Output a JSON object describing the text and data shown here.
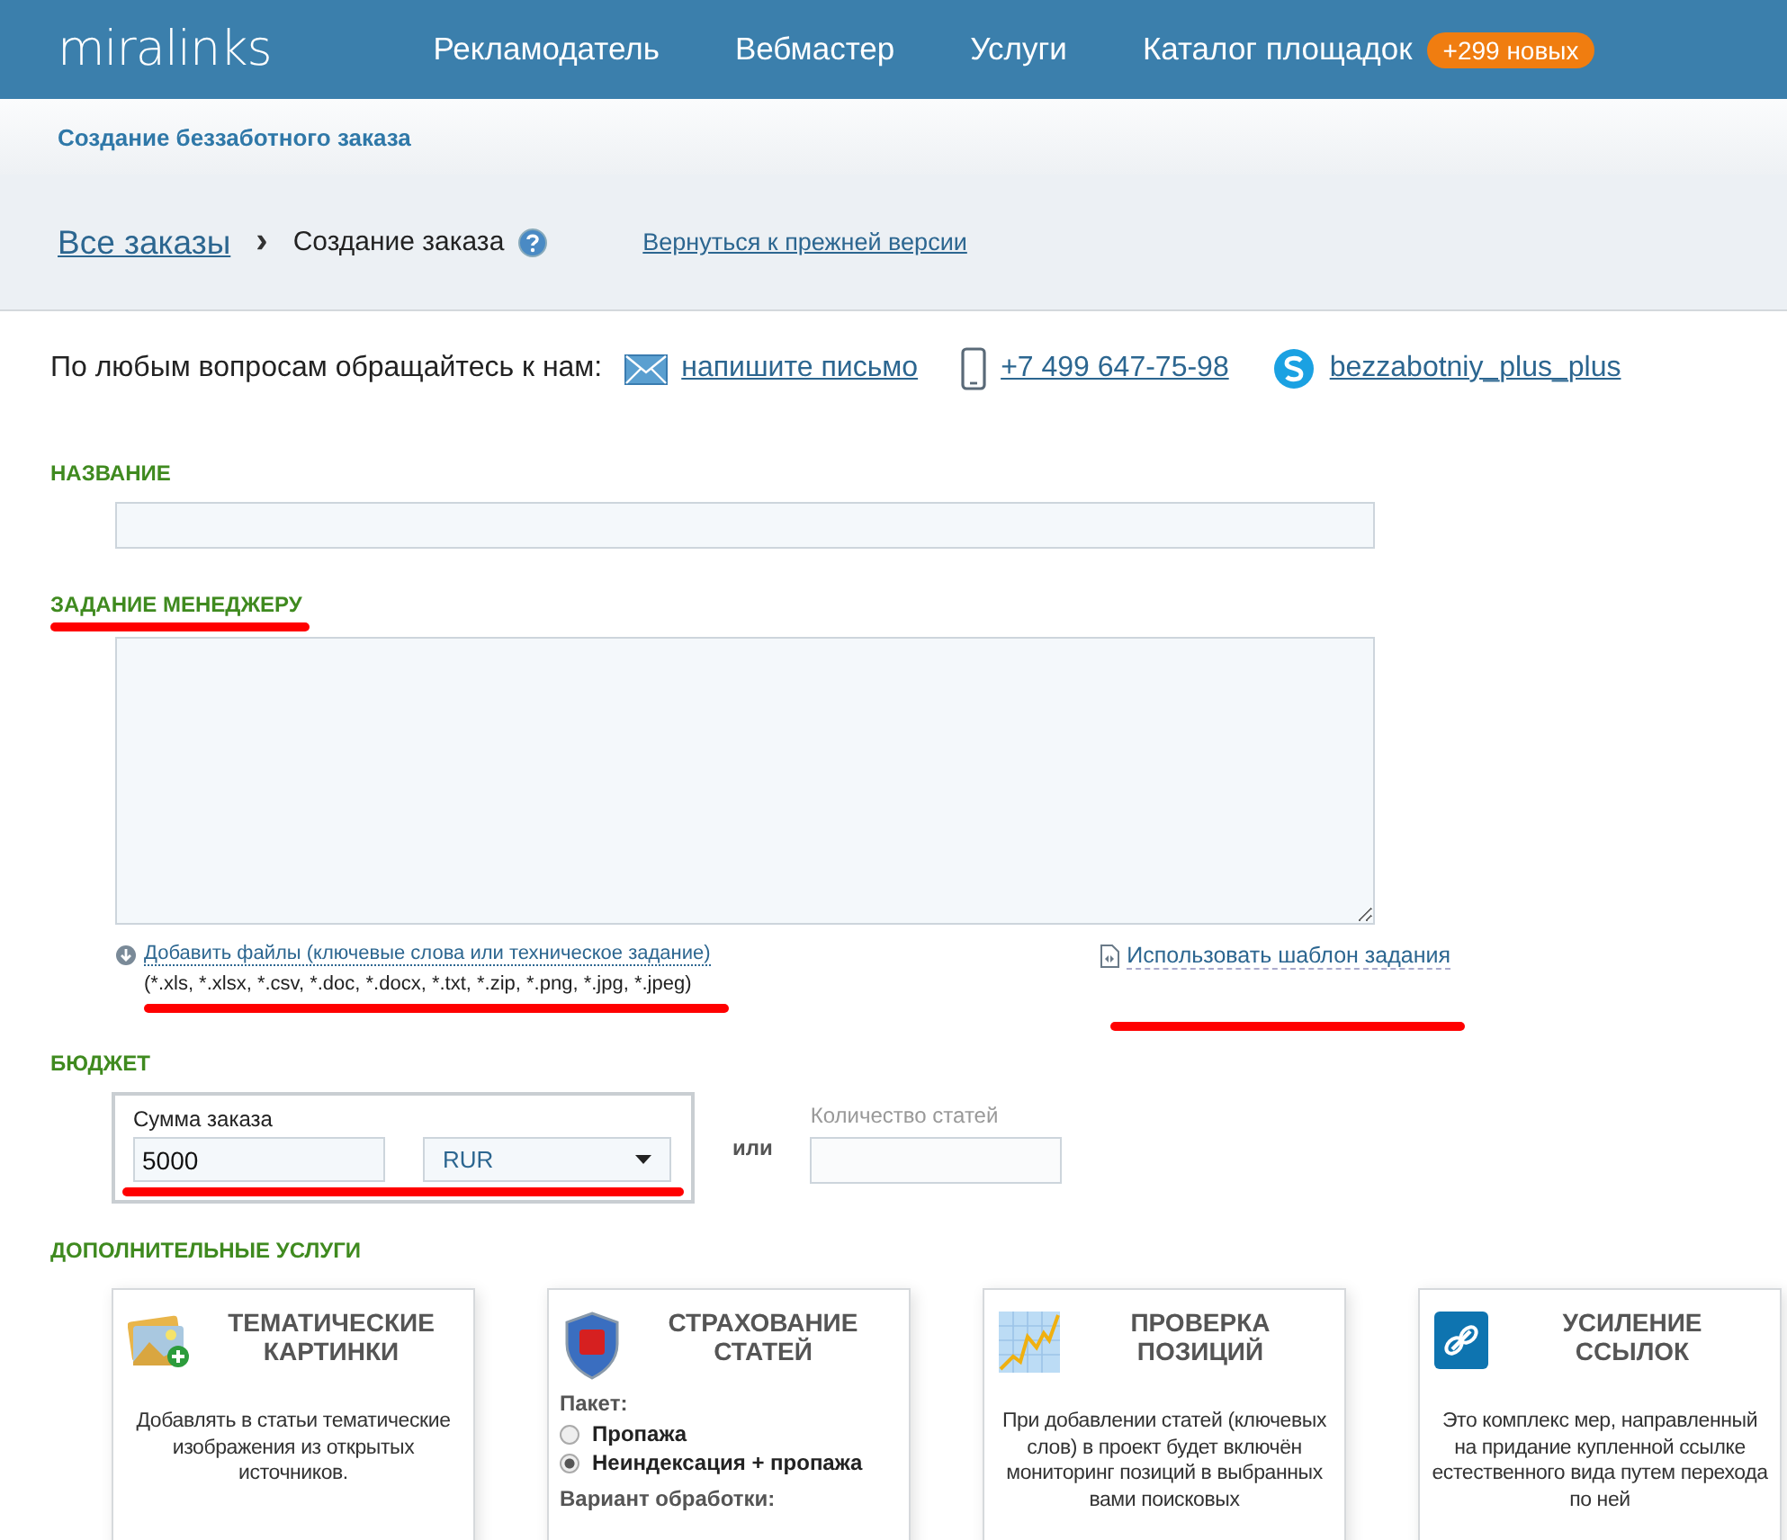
{
  "header": {
    "logo": "miralinks",
    "nav": [
      {
        "label": "Рекламодатель"
      },
      {
        "label": "Вебмастер"
      },
      {
        "label": "Услуги"
      },
      {
        "label": "Каталог площадок",
        "badge": "+299 новых"
      }
    ]
  },
  "subheader": {
    "title": "Создание беззаботного заказа"
  },
  "breadcrumb": {
    "link": "Все заказы",
    "separator": "›",
    "current": "Создание заказа",
    "old_version_link": "Вернуться к прежней версии"
  },
  "contacts": {
    "label": "По любым вопросам обращайтесь к нам:",
    "items": [
      {
        "kind": "mail",
        "text": "напишите письмо"
      },
      {
        "kind": "phone",
        "text": "+7 499 647-75-98"
      },
      {
        "kind": "skype",
        "text": "bezzabotniy_plus_plus"
      }
    ]
  },
  "name_section": {
    "title": "НАЗВАНИЕ"
  },
  "task_section": {
    "title": "ЗАДАНИЕ МЕНЕДЖЕРУ",
    "add_files": "Добавить файлы (ключевые слова или техническое задание)",
    "formats": "(*.xls, *.xlsx, *.csv, *.doc, *.docx, *.txt, *.zip, *.png, *.jpg, *.jpeg)",
    "template_link": "Использовать шаблон задания"
  },
  "budget_section": {
    "title": "БЮДЖЕТ",
    "sum_label": "Сумма заказа",
    "sum_value": "5000",
    "currency": "RUR",
    "or": "или",
    "count_label": "Количество статей"
  },
  "extra_section": {
    "title": "ДОПОЛНИТЕЛЬНЫЕ УСЛУГИ",
    "cards": [
      {
        "kind": "pictures",
        "title": "ТЕМАТИЧЕСКИЕ КАРТИНКИ",
        "text": "Добавлять в статьи тематические изображения из открытых источников."
      },
      {
        "kind": "insurance",
        "title": "СТРАХОВАНИЕ СТАТЕЙ",
        "package_label": "Пакет:",
        "options": [
          {
            "label": "Пропажа",
            "selected": false
          },
          {
            "label": "Неиндексация + пропажа",
            "selected": true
          }
        ],
        "variant_label": "Вариант обработки:"
      },
      {
        "kind": "positions",
        "title": "ПРОВЕРКА ПОЗИЦИЙ",
        "text": "При добавлении статей (ключевых слов) в проект будет включён мониторинг позиций в выбранных вами поисковых"
      },
      {
        "kind": "links",
        "title": "УСИЛЕНИЕ ССЫЛОК",
        "text": "Это комплекс мер, направленный на придание купленной ссылке естественного вида путем перехода по ней"
      }
    ]
  }
}
